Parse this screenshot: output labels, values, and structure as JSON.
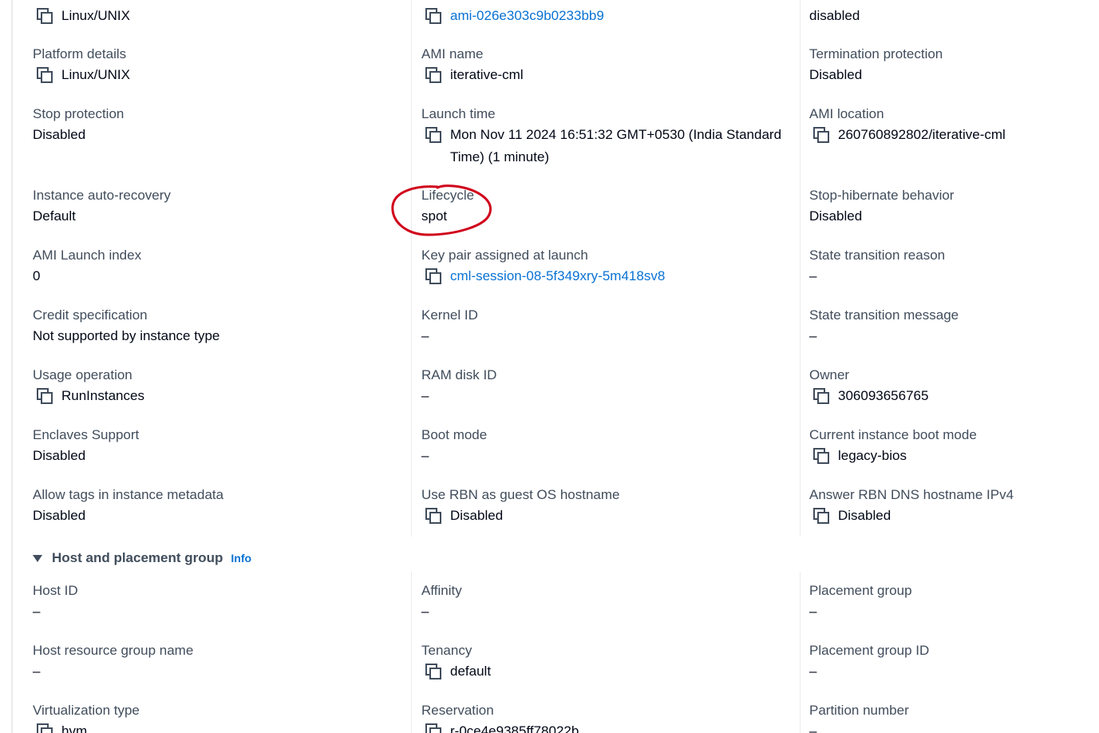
{
  "top_row": [
    {
      "value": "Linux/UNIX",
      "copy": true,
      "link": false
    },
    {
      "value": "ami-026e303c9b0233bb9",
      "copy": true,
      "link": true
    },
    {
      "value": "disabled",
      "copy": false,
      "link": false
    }
  ],
  "details": {
    "col1": [
      {
        "label": "Platform details",
        "value": "Linux/UNIX",
        "copy": true
      },
      {
        "label": "Stop protection",
        "value": "Disabled",
        "copy": false
      },
      {
        "label": "Instance auto-recovery",
        "value": "Default",
        "copy": false
      },
      {
        "label": "AMI Launch index",
        "value": "0",
        "copy": false
      },
      {
        "label": "Credit specification",
        "value": "Not supported by instance type",
        "copy": false
      },
      {
        "label": "Usage operation",
        "value": "RunInstances",
        "copy": true
      },
      {
        "label": "Enclaves Support",
        "value": "Disabled",
        "copy": false
      },
      {
        "label": "Allow tags in instance metadata",
        "value": "Disabled",
        "copy": false
      }
    ],
    "col2": [
      {
        "label": "AMI name",
        "value": "iterative-cml",
        "copy": true
      },
      {
        "label": "Launch time",
        "value": "Mon Nov 11 2024 16:51:32 GMT+0530 (India Standard Time) (1 minute)",
        "copy": true
      },
      {
        "label": "Lifecycle",
        "value": "spot",
        "copy": false
      },
      {
        "label": "Key pair assigned at launch",
        "value": "cml-session-08-5f349xry-5m418sv8",
        "copy": true,
        "link": true
      },
      {
        "label": "Kernel ID",
        "value": "–",
        "copy": false
      },
      {
        "label": "RAM disk ID",
        "value": "–",
        "copy": false
      },
      {
        "label": "Boot mode",
        "value": "–",
        "copy": false
      },
      {
        "label": "Use RBN as guest OS hostname",
        "value": "Disabled",
        "copy": true
      }
    ],
    "col3": [
      {
        "label": "Termination protection",
        "value": "Disabled",
        "copy": false
      },
      {
        "label": "AMI location",
        "value": "260760892802/iterative-cml",
        "copy": true
      },
      {
        "label": "Stop-hibernate behavior",
        "value": "Disabled",
        "copy": false
      },
      {
        "label": "State transition reason",
        "value": "–",
        "copy": false
      },
      {
        "label": "State transition message",
        "value": "–",
        "copy": false
      },
      {
        "label": "Owner",
        "value": "306093656765",
        "copy": true
      },
      {
        "label": "Current instance boot mode",
        "value": "legacy-bios",
        "copy": true
      },
      {
        "label": "Answer RBN DNS hostname IPv4",
        "value": "Disabled",
        "copy": true
      }
    ]
  },
  "host_section": {
    "title": "Host and placement group",
    "info_label": "Info",
    "col1": [
      {
        "label": "Host ID",
        "value": "–",
        "copy": false
      },
      {
        "label": "Host resource group name",
        "value": "–",
        "copy": false
      },
      {
        "label": "Virtualization type",
        "value": "hvm",
        "copy": true
      }
    ],
    "col2": [
      {
        "label": "Affinity",
        "value": "–",
        "copy": false
      },
      {
        "label": "Tenancy",
        "value": "default",
        "copy": true
      },
      {
        "label": "Reservation",
        "value": "r-0ce4e9385ff78022b",
        "copy": true
      }
    ],
    "col3": [
      {
        "label": "Placement group",
        "value": "–",
        "copy": false
      },
      {
        "label": "Placement group ID",
        "value": "–",
        "copy": false
      },
      {
        "label": "Partition number",
        "value": "–",
        "copy": false
      }
    ]
  },
  "colors": {
    "link": "#0972d3",
    "label": "#414d5c",
    "value": "#000716",
    "annotation": "#d0021b"
  },
  "icons": {
    "copy": "copy-icon",
    "caret": "caret-down-icon"
  }
}
